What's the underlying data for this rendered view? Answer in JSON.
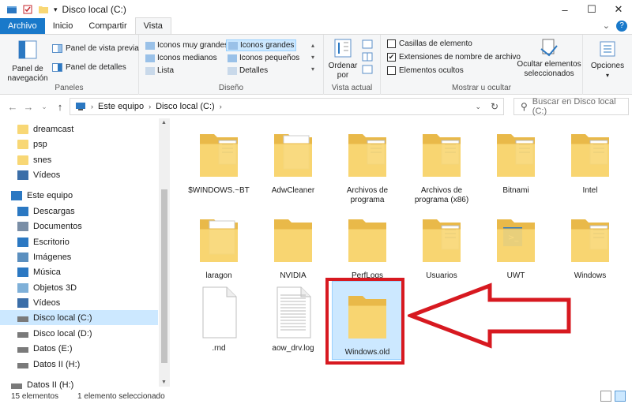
{
  "window": {
    "title": "Disco local (C:)",
    "controls": [
      "–",
      "☐",
      "✕"
    ]
  },
  "ribbon": {
    "tabs": [
      "Archivo",
      "Inicio",
      "Compartir",
      "Vista"
    ],
    "active_tab": "Vista",
    "groups": {
      "paneles": {
        "label": "Paneles",
        "nav_pane": "Panel de navegación",
        "preview": "Panel de vista previa",
        "details": "Panel de detalles"
      },
      "diseno": {
        "label": "Diseño",
        "items": [
          "Iconos muy grandes",
          "Iconos grandes",
          "Iconos medianos",
          "Iconos pequeños",
          "Lista",
          "Detalles"
        ],
        "selected": "Iconos grandes"
      },
      "vista_actual": {
        "label": "Vista actual",
        "sort": "Ordenar por"
      },
      "mostrar": {
        "label": "Mostrar u ocultar",
        "checkboxes": [
          {
            "label": "Casillas de elemento",
            "checked": false
          },
          {
            "label": "Extensiones de nombre de archivo",
            "checked": true
          },
          {
            "label": "Elementos ocultos",
            "checked": false
          }
        ],
        "hide_selected": "Ocultar elementos seleccionados"
      },
      "opciones": {
        "label": "Opciones"
      }
    }
  },
  "address": {
    "path": [
      "Este equipo",
      "Disco local (C:)"
    ],
    "search_placeholder": "Buscar en Disco local (C:)"
  },
  "sidebar": {
    "items": [
      {
        "label": "dreamcast",
        "icon": "folder-icon"
      },
      {
        "label": "psp",
        "icon": "folder-icon"
      },
      {
        "label": "snes",
        "icon": "folder-icon"
      },
      {
        "label": "Vídeos",
        "icon": "videos-icon"
      },
      {
        "label": "Este equipo",
        "icon": "computer-icon"
      },
      {
        "label": "Descargas",
        "icon": "download-icon"
      },
      {
        "label": "Documentos",
        "icon": "documents-icon"
      },
      {
        "label": "Escritorio",
        "icon": "desktop-icon"
      },
      {
        "label": "Imágenes",
        "icon": "pictures-icon"
      },
      {
        "label": "Música",
        "icon": "music-icon"
      },
      {
        "label": "Objetos 3D",
        "icon": "cube-icon"
      },
      {
        "label": "Vídeos",
        "icon": "videos-icon"
      },
      {
        "label": "Disco local (C:)",
        "icon": "drive-icon",
        "selected": true
      },
      {
        "label": "Disco local (D:)",
        "icon": "drive-icon"
      },
      {
        "label": "Datos (E:)",
        "icon": "drive-icon"
      },
      {
        "label": "Datos II (H:)",
        "icon": "drive-icon"
      },
      {
        "label": "Datos II (H:)",
        "icon": "drive-icon"
      }
    ]
  },
  "files": [
    {
      "name": "$WINDOWS.~BT",
      "type": "folder-docs"
    },
    {
      "name": "AdwCleaner",
      "type": "folder-white"
    },
    {
      "name": "Archivos de programa",
      "type": "folder-docs"
    },
    {
      "name": "Archivos de programa (x86)",
      "type": "folder-docs"
    },
    {
      "name": "Bitnami",
      "type": "folder-docs"
    },
    {
      "name": "Intel",
      "type": "folder-docs"
    },
    {
      "name": "laragon",
      "type": "folder-white"
    },
    {
      "name": "NVIDIA",
      "type": "folder"
    },
    {
      "name": "PerfLogs",
      "type": "folder"
    },
    {
      "name": "Usuarios",
      "type": "folder-docs"
    },
    {
      "name": "UWT",
      "type": "folder-ps"
    },
    {
      "name": "Windows",
      "type": "folder-docs"
    },
    {
      "name": ".rnd",
      "type": "file"
    },
    {
      "name": "aow_drv.log",
      "type": "file-text"
    },
    {
      "name": "Windows.old",
      "type": "folder",
      "selected": true
    }
  ],
  "status": {
    "count": "15 elementos",
    "selection": "1 elemento seleccionado"
  },
  "colors": {
    "accent": "#1979ca",
    "selection": "#cce8ff",
    "annotation": "#d71920",
    "folder": "#f8d775"
  }
}
